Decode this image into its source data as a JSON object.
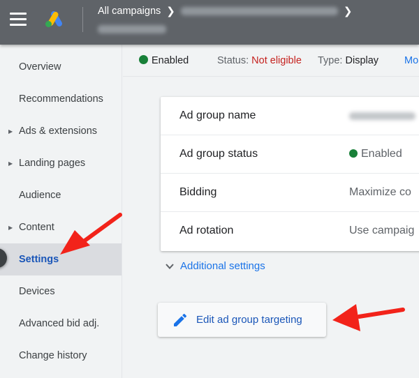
{
  "topbar": {
    "menu_icon": "hamburger-menu-icon",
    "logo_icon": "google-ads-logo-icon",
    "breadcrumb": {
      "root": "All campaigns",
      "separator_icon": "chevron-right-icon",
      "campaign_name_redacted": true,
      "ad_group_name_redacted": true
    }
  },
  "sidebar": {
    "items": [
      {
        "label": "Overview",
        "expandable": false,
        "active": false
      },
      {
        "label": "Recommendations",
        "expandable": false,
        "active": false
      },
      {
        "label": "Ads & extensions",
        "expandable": true,
        "active": false
      },
      {
        "label": "Landing pages",
        "expandable": true,
        "active": false
      },
      {
        "label": "Audience",
        "expandable": false,
        "active": false
      },
      {
        "label": "Content",
        "expandable": true,
        "active": false
      },
      {
        "label": "Settings",
        "expandable": false,
        "active": true
      },
      {
        "label": "Devices",
        "expandable": false,
        "active": false
      },
      {
        "label": "Advanced bid adj.",
        "expandable": false,
        "active": false
      },
      {
        "label": "Change history",
        "expandable": false,
        "active": false
      }
    ]
  },
  "status_strip": {
    "enabled_label": "Enabled",
    "status_label": "Status:",
    "status_value": "Not eligible",
    "type_label": "Type:",
    "type_value": "Display",
    "more_link": "Mo"
  },
  "settings_card": {
    "rows": [
      {
        "label": "Ad group name",
        "value": "",
        "redacted": true
      },
      {
        "label": "Ad group status",
        "value": "Enabled",
        "status_dot": true
      },
      {
        "label": "Bidding",
        "value": "Maximize co"
      },
      {
        "label": "Ad rotation",
        "value": "Use campaig"
      }
    ]
  },
  "additional_settings": "Additional settings",
  "edit_button": {
    "label": "Edit ad group targeting",
    "icon": "pencil-icon"
  },
  "annotations": {
    "arrows": [
      "arrow-pointing-to-settings",
      "arrow-pointing-to-edit-button"
    ],
    "color": "#f2231a"
  },
  "colors": {
    "topbar": "#5f6368",
    "status_green": "#188038",
    "status_red": "#c5221f",
    "link_blue": "#1a73e8",
    "active_blue": "#1a56b8"
  }
}
